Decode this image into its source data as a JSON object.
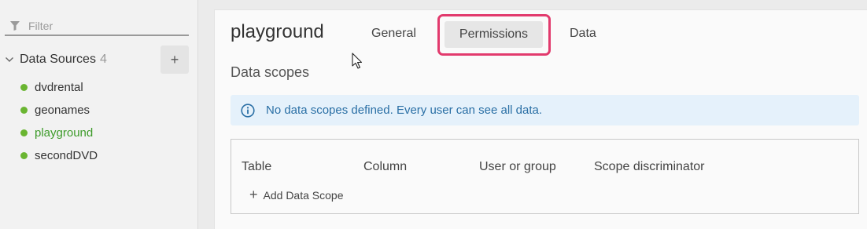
{
  "sidebar": {
    "filter_placeholder": "Filter",
    "data_sources_label": "Data Sources",
    "data_sources_count": "4",
    "add_label": "+",
    "items": [
      {
        "label": "dvdrental",
        "active": false
      },
      {
        "label": "geonames",
        "active": false
      },
      {
        "label": "playground",
        "active": true
      },
      {
        "label": "secondDVD",
        "active": false
      }
    ]
  },
  "main": {
    "title": "playground",
    "tabs": [
      {
        "label": "General"
      },
      {
        "label": "Permissions"
      },
      {
        "label": "Data"
      }
    ],
    "section_title": "Data scopes",
    "info_text": "No data scopes defined. Every user can see all data.",
    "table": {
      "headers": [
        "Table",
        "Column",
        "User or group",
        "Scope discriminator"
      ],
      "add_label": "Add Data Scope"
    }
  },
  "colors": {
    "status_dot": "#6ab531",
    "active_item": "#3d9b2a",
    "highlight": "#e23a6d",
    "info_bg": "#e5f1fb",
    "info_text": "#2a6fa5"
  }
}
